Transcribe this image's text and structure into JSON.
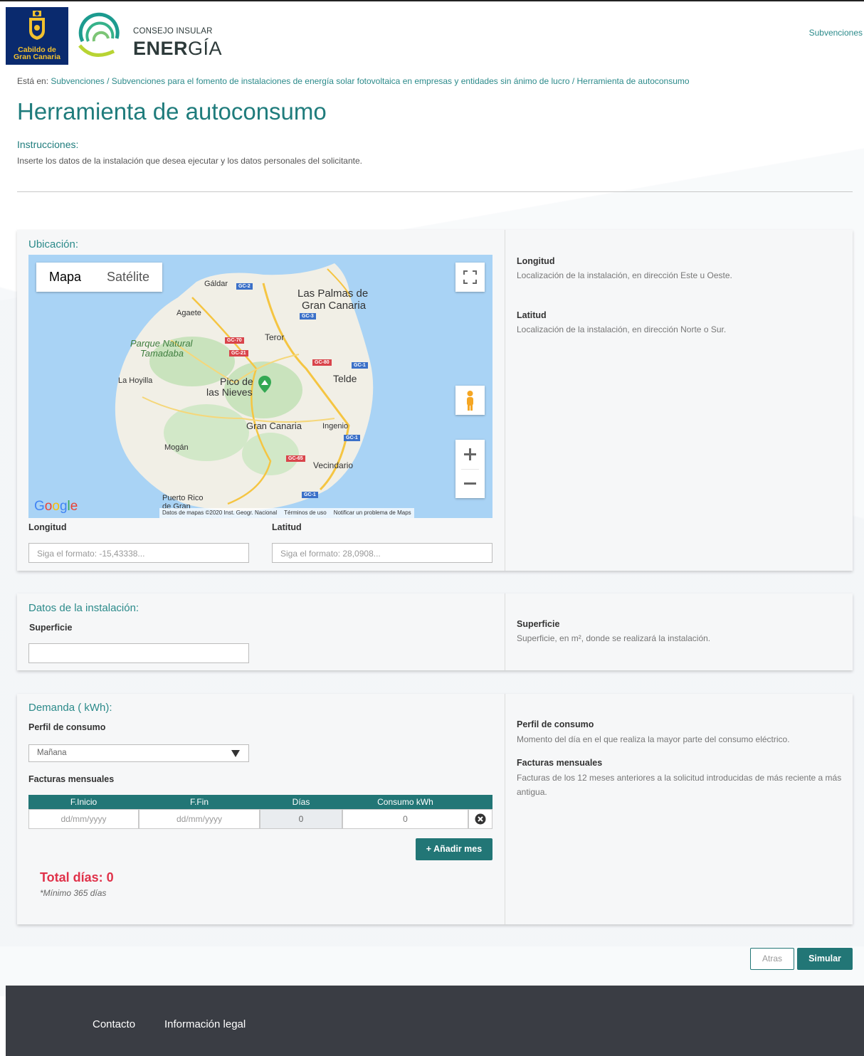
{
  "header": {
    "cabildo_logo_text": [
      "Cabildo de",
      "Gran Canaria"
    ],
    "energia_logo_line1": "CONSEJO INSULAR",
    "energia_logo_line2_bold": "ENER",
    "energia_logo_line2_rest": "GÍA",
    "nav_link": "Subvenciones"
  },
  "breadcrumb": {
    "prefix": "Está en:",
    "path": "Subvenciones / Subvenciones para el fomento de instalaciones de energía solar fotovoltaica en empresas y entidades sin ánimo de lucro / Herramienta de autoconsumo"
  },
  "page": {
    "title": "Herramienta de autoconsumo",
    "instructions_title": "Instrucciones:",
    "instructions_text": "Inserte los datos de la instalación que desea ejecutar y los datos personales del solicitante."
  },
  "location": {
    "title": "Ubicación:",
    "map": {
      "type_map": "Mapa",
      "type_satellite": "Satélite",
      "places": {
        "galdar": "Gáldar",
        "las_palmas_1": "Las Palmas de",
        "las_palmas_2": "Gran Canaria",
        "agaete": "Agaete",
        "parque_1": "Parque Natural",
        "parque_2": "Tamadaba",
        "teror": "Teror",
        "la_hoyilla": "La Hoyilla",
        "pico_1": "Pico de",
        "pico_2": "las Nieves",
        "telde": "Telde",
        "gran_canaria": "Gran Canaria",
        "ingenio": "Ingenio",
        "mogan": "Mogán",
        "vecindario": "Vecindario",
        "puerto_rico": "Puerto Rico",
        "de_gran": "de Gran"
      },
      "roads": {
        "gc2": "GC-2",
        "gc3": "GC-3",
        "gc70": "GC-70",
        "gc21": "GC-21",
        "gc80": "GC-80",
        "gc1a": "GC-1",
        "gc1b": "GC-1",
        "gc65": "GC-65",
        "gc1c": "GC-1"
      },
      "google": "Google",
      "footer_data": "Datos de mapas ©2020 Inst. Geogr. Nacional",
      "footer_terms": "Términos de uso",
      "footer_report": "Notificar un problema de Maps"
    },
    "longitude_label": "Longitud",
    "longitude_placeholder": "Siga el formato: -15,43338...",
    "latitude_label": "Latitud",
    "latitude_placeholder": "Siga el formato: 28,0908...",
    "help": {
      "longitude_title": "Longitud",
      "longitude_text": "Localización de la instalación, en dirección Este u Oeste.",
      "latitude_title": "Latitud",
      "latitude_text": "Localización de la instalación, en dirección Norte o Sur."
    }
  },
  "installation": {
    "title": "Datos de la instalación:",
    "surface_label": "Superficie",
    "surface_value": "",
    "help": {
      "surface_title": "Superficie",
      "surface_text": "Superficie, en m², donde se realizará la instalación."
    }
  },
  "demand": {
    "title": "Demanda ( kWh):",
    "profile_label": "Perfil de consumo",
    "profile_selected": "Mañana",
    "invoices_label": "Facturas mensuales",
    "table": {
      "headers": [
        "F.Inicio",
        "F.Fin",
        "Días",
        "Consumo kWh"
      ],
      "row": {
        "start_placeholder": "dd/mm/yyyy",
        "end_placeholder": "dd/mm/yyyy",
        "days": "0",
        "consumption": "0"
      }
    },
    "add_month_button": "+ Añadir mes",
    "total_days": "Total días: 0",
    "min_note": "*Mínimo 365 días",
    "help": {
      "profile_title": "Perfil de consumo",
      "profile_text": "Momento del día en el que realiza la mayor parte del consumo eléctrico.",
      "invoices_title": "Facturas mensuales",
      "invoices_text": "Facturas de los 12 meses anteriores a la solicitud introducidas de más reciente a más antigua."
    }
  },
  "actions": {
    "back": "Atras",
    "simulate": "Simular"
  },
  "footer": {
    "contact": "Contacto",
    "legal": "Información legal"
  },
  "colors": {
    "accent": "#227676",
    "title_teal": "#1f7c7c",
    "total_red": "#e0324a",
    "footer_bg": "#3a3d44",
    "cabildo_blue": "#0a2a6e"
  }
}
